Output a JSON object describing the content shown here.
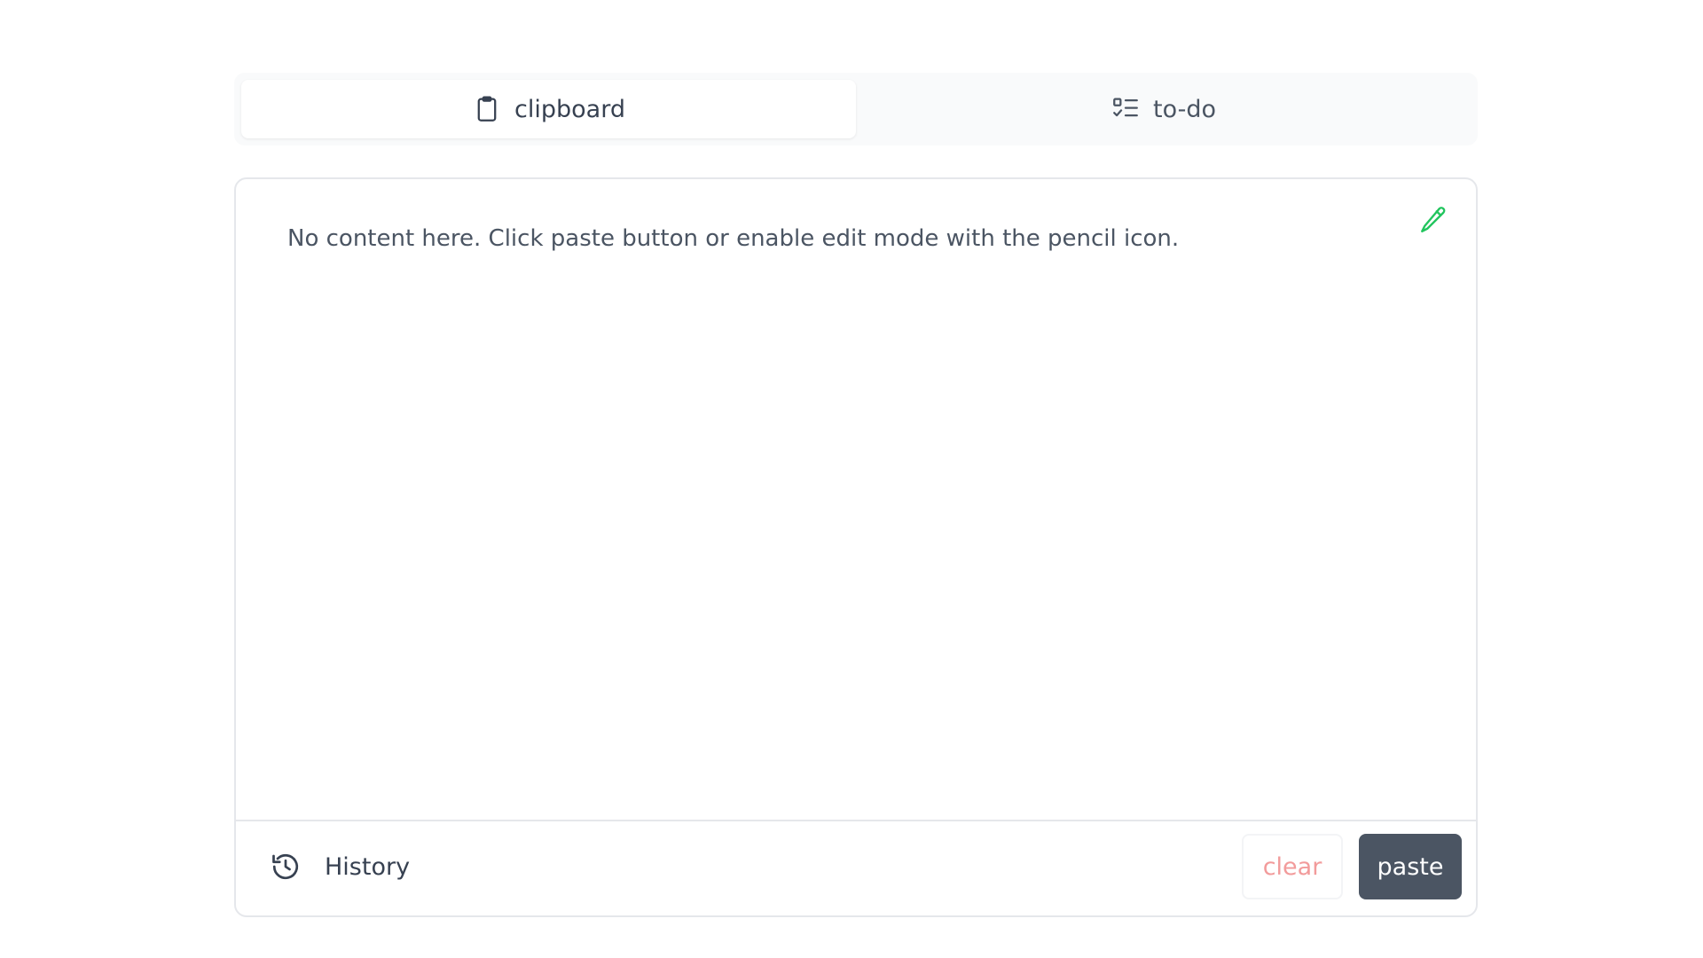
{
  "tabs": [
    {
      "label": "clipboard",
      "icon": "clipboard-icon",
      "active": true
    },
    {
      "label": "to-do",
      "icon": "checklist-icon",
      "active": false
    }
  ],
  "content": {
    "placeholder": "No content here. Click paste button or enable edit mode with the pencil icon.",
    "edit_icon": "pencil-icon"
  },
  "footer": {
    "history_label": "History",
    "history_icon": "history-icon",
    "clear_label": "clear",
    "paste_label": "paste"
  },
  "colors": {
    "accent_edit": "#22c55e",
    "clear_text": "#f29b9b",
    "paste_bg": "#4b5563"
  }
}
